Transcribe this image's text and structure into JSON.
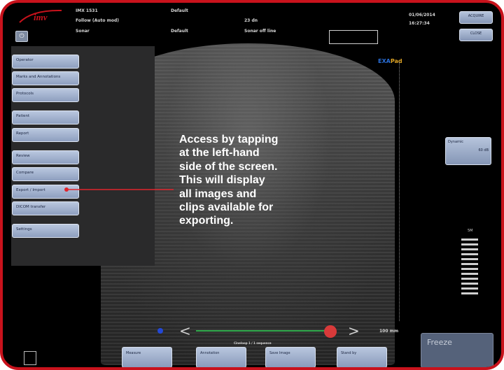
{
  "header": {
    "col1": [
      "IMX 1531",
      "Follow (Auto mod)",
      "Sonar"
    ],
    "col2": [
      "Default",
      "",
      "Default"
    ],
    "col3": [
      "",
      "23 dn",
      "Sonar off line"
    ],
    "date": "01/06/2014",
    "time": "16:27:34",
    "buttons": [
      "ACQUIRE",
      "CLOSE"
    ]
  },
  "menu": {
    "items": [
      "Operator",
      "Marks and Annotations",
      "Protocols",
      "Patient",
      "Report",
      "Review",
      "Compare",
      "Export / Import",
      "DICOM transfer",
      "Settings"
    ]
  },
  "image": {
    "brand": "EXAPad",
    "dynamic": {
      "label": "Dynamic",
      "value": "60 dB"
    },
    "depth_label": "5M",
    "depth_text": "100 mm",
    "callout": "Access by tapping\nat the left-hand\nside of the screen.\nThis will display\nall images and\nclips available for\nexporting."
  },
  "bottom": {
    "buttons": [
      "Measure",
      "Annotation",
      "Save Image",
      "Stand by"
    ],
    "freeze": "Freeze",
    "center_label": "Cineloop 1 / 1 sequence"
  },
  "colors": {
    "frame": "#c8121c",
    "accent": "#e0a526",
    "menu_btn": "#a8b7d4"
  }
}
